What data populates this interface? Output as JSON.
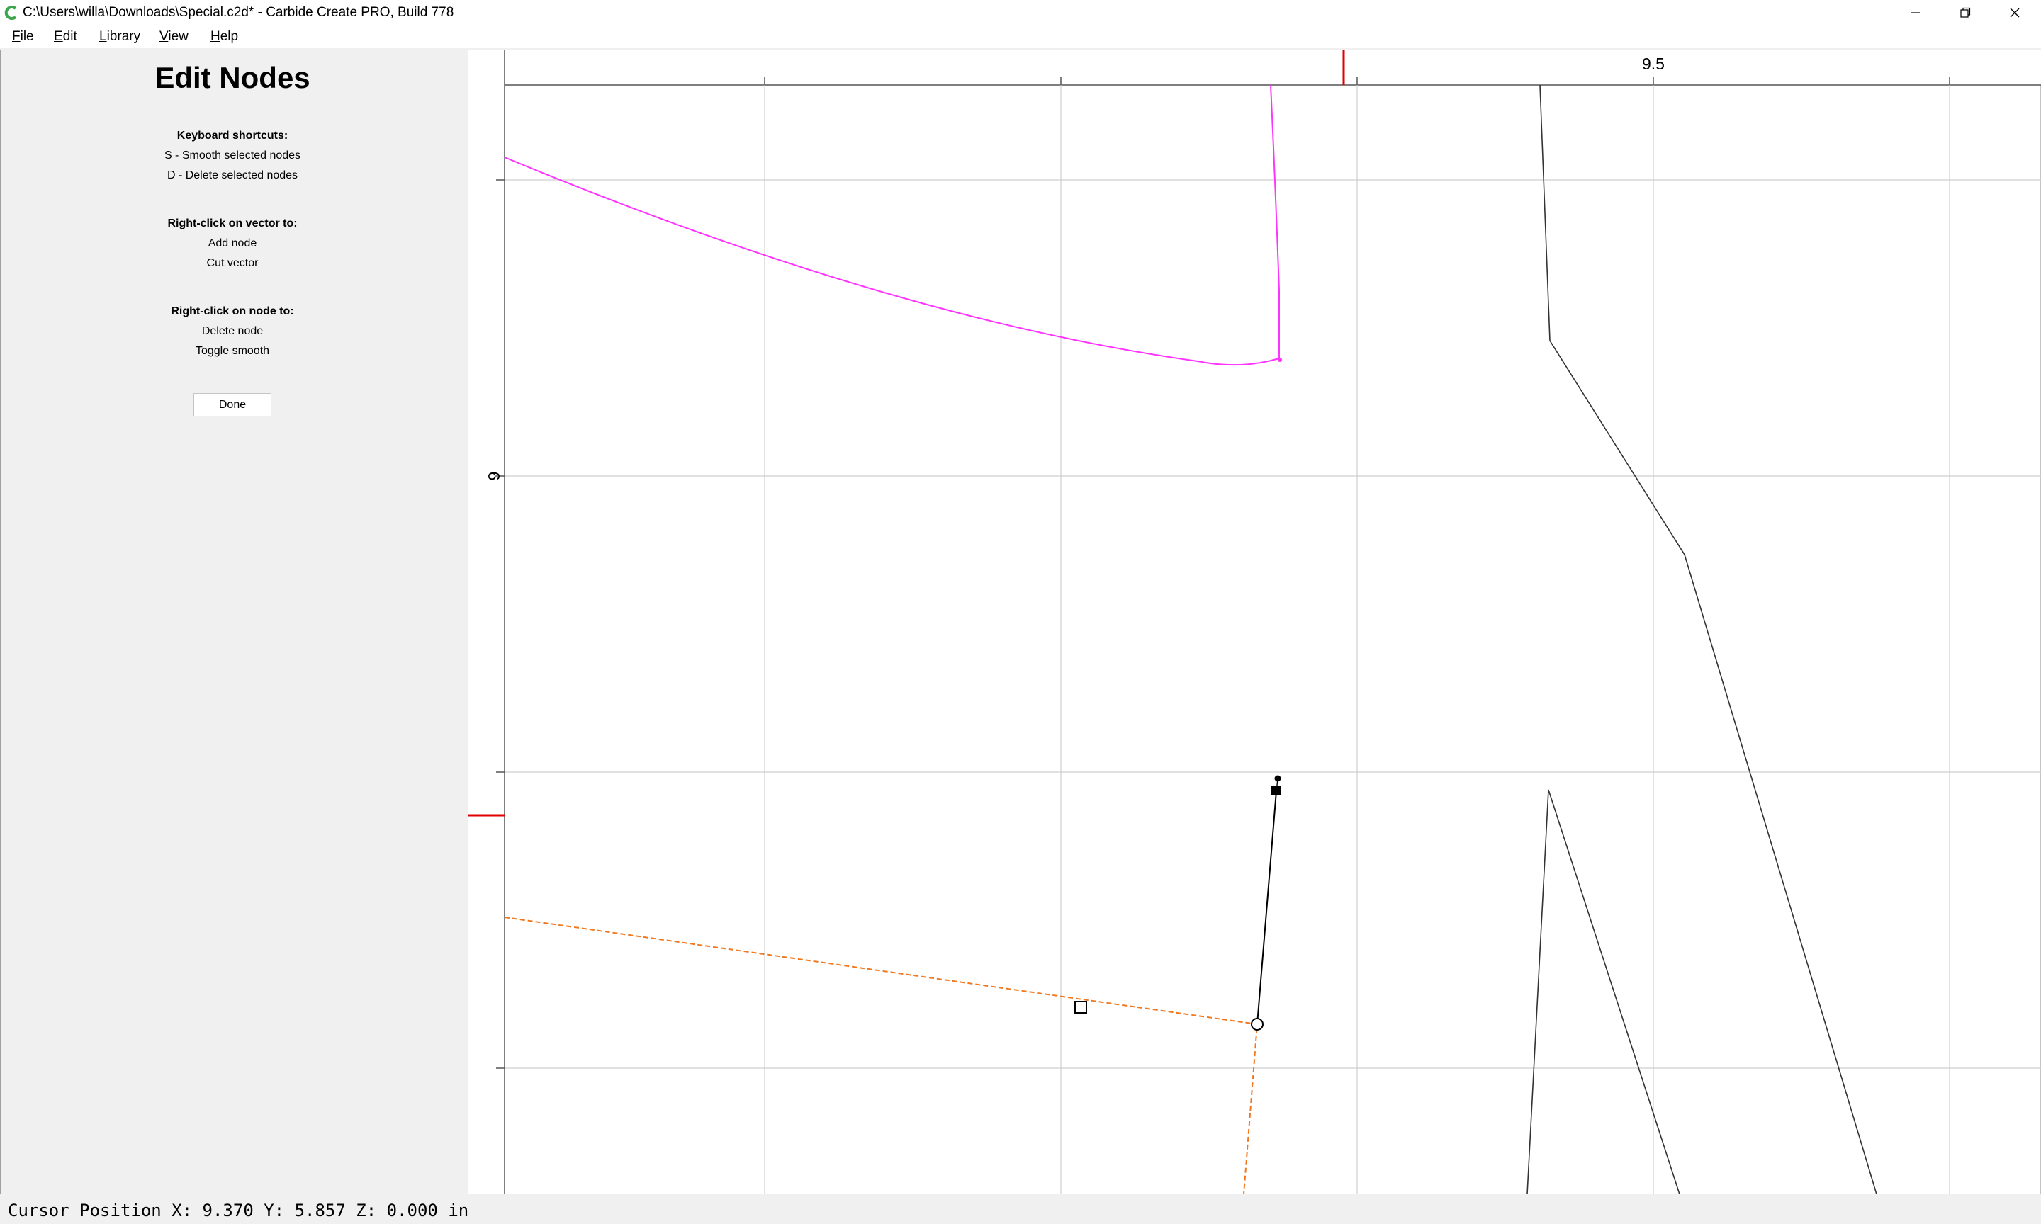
{
  "window": {
    "title": "C:\\Users\\willa\\Downloads\\Special.c2d* - Carbide Create PRO, Build 778",
    "icon": "carbide-create-logo-icon",
    "controls": [
      "minimize-icon",
      "restore-icon",
      "close-icon"
    ]
  },
  "menu": {
    "file": "File",
    "edit": "Edit",
    "library": "Library",
    "view": "View",
    "help": "Help"
  },
  "panel": {
    "title": "Edit Nodes",
    "shortcuts_heading": "Keyboard shortcuts:",
    "shortcut_s": "S - Smooth selected nodes",
    "shortcut_d": "D - Delete selected nodes",
    "vector_heading": "Right-click on vector to:",
    "vector_add": "Add node",
    "vector_cut": "Cut vector",
    "node_heading": "Right-click on node to:",
    "node_delete": "Delete node",
    "node_toggle": "Toggle smooth",
    "done_label": "Done"
  },
  "canvas": {
    "ruler_x_label": "9.5",
    "ruler_y_label": "6",
    "colors": {
      "grid": "#cfcfcf",
      "magenta_vector": "#ff33ff",
      "selected_vector": "#f07820",
      "cursor_marker": "#e00000",
      "vector": "#333333"
    }
  },
  "status": {
    "cursor_position": "Cursor Position X: 9.370 Y: 5.857 Z: 0.000 in"
  }
}
